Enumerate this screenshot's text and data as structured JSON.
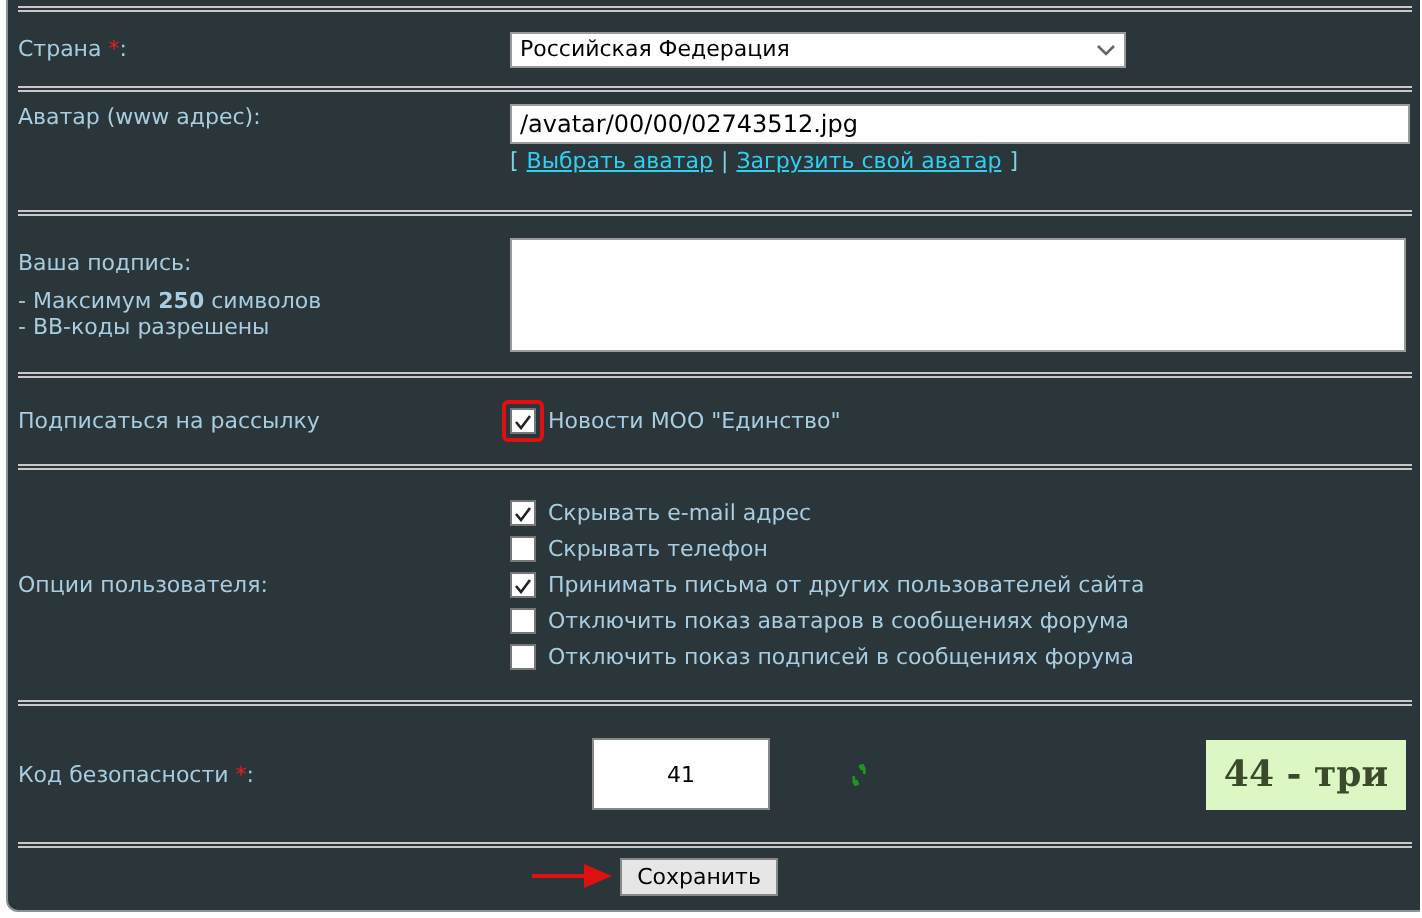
{
  "rows": [
    {
      "kind": "select",
      "label": "Страна",
      "required_mark": "*",
      "label_end": ":",
      "value": "Российская Федерация"
    },
    {
      "kind": "avatar",
      "label": "Аватар (www адрес):",
      "value": "/avatar/00/00/02743512.jpg",
      "bracket_open": "[",
      "links": [
        "Выбрать аватар",
        "Загрузить свой аватар"
      ],
      "separator": "|",
      "bracket_close": "]"
    },
    {
      "kind": "textarea",
      "label": "Ваша подпись:",
      "notes": [
        "- Максимум **250** символов",
        "- BB-коды разрешены"
      ]
    },
    {
      "kind": "checks",
      "label": "Подписаться на рассылку",
      "options": [
        {
          "label": "Новости МОО \"Единство\"",
          "checked": true,
          "highlighted": true
        }
      ]
    },
    {
      "kind": "checks",
      "label": "Опции пользователя:",
      "options": [
        {
          "label": "Скрывать e-mail адрес",
          "checked": true,
          "highlighted": false
        },
        {
          "label": "Скрывать телефон",
          "checked": false,
          "highlighted": false
        },
        {
          "label": "Принимать письма от других пользователей сайта",
          "checked": true,
          "highlighted": false
        },
        {
          "label": "Отключить показ аватаров в сообщениях форума",
          "checked": false,
          "highlighted": false
        },
        {
          "label": "Отключить показ подписей в сообщениях форума",
          "checked": false,
          "highlighted": false
        }
      ]
    },
    {
      "kind": "captcha",
      "label": "Код безопасности",
      "required_mark": "*",
      "label_end": ":",
      "value": "41",
      "captcha": "44 - три"
    }
  ],
  "submit": {
    "label": "Сохранить",
    "pointer_arrow": true
  }
}
